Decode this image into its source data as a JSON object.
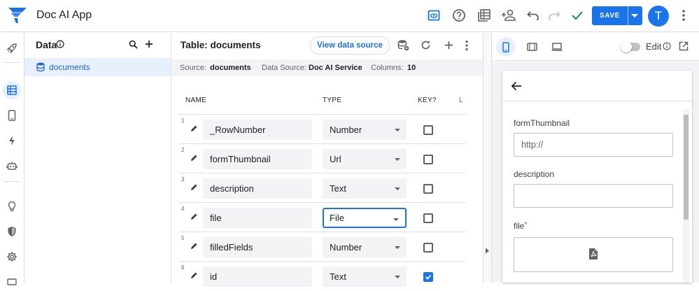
{
  "app": {
    "title": "Doc AI App",
    "accent": "#1a73e8"
  },
  "topbar": {
    "icons": [
      "preview-icon",
      "help-icon",
      "table-view-icon",
      "add-user-icon",
      "undo-icon",
      "redo-icon",
      "check-icon"
    ],
    "save_label": "SAVE",
    "avatar_letter": "T"
  },
  "rail": {
    "icons": [
      "rocket-icon",
      "data-icon",
      "phone-icon",
      "bolt-icon",
      "robot-icon",
      "lightbulb-icon",
      "shield-icon",
      "settings-icon"
    ]
  },
  "data_panel": {
    "title": "Data",
    "items": [
      {
        "label": "documents"
      }
    ]
  },
  "main": {
    "title": "Table: documents",
    "view_data_source": "View data source",
    "info": {
      "source_label": "Source:",
      "source_value": "documents",
      "datasource_label": "Data Source:",
      "datasource_value": "Doc AI Service",
      "columns_label": "Columns:",
      "columns_value": "10"
    },
    "headers": {
      "name": "NAME",
      "type": "TYPE",
      "key": "KEY?",
      "extra": "L"
    },
    "rows": [
      {
        "num": "1",
        "name": "_RowNumber",
        "type": "Number",
        "key": false
      },
      {
        "num": "2",
        "name": "formThumbnail",
        "type": "Url",
        "key": false
      },
      {
        "num": "3",
        "name": "description",
        "type": "Text",
        "key": false
      },
      {
        "num": "4",
        "name": "file",
        "type": "File",
        "key": false
      },
      {
        "num": "5",
        "name": "filledFields",
        "type": "Number",
        "key": false
      },
      {
        "num": "6",
        "name": "id",
        "type": "Text",
        "key": true
      }
    ]
  },
  "preview": {
    "edit_label": "Edit",
    "fields": [
      {
        "label": "formThumbnail",
        "value": "http://"
      },
      {
        "label": "description",
        "value": ""
      },
      {
        "label": "file",
        "required_mark": "*"
      }
    ]
  }
}
